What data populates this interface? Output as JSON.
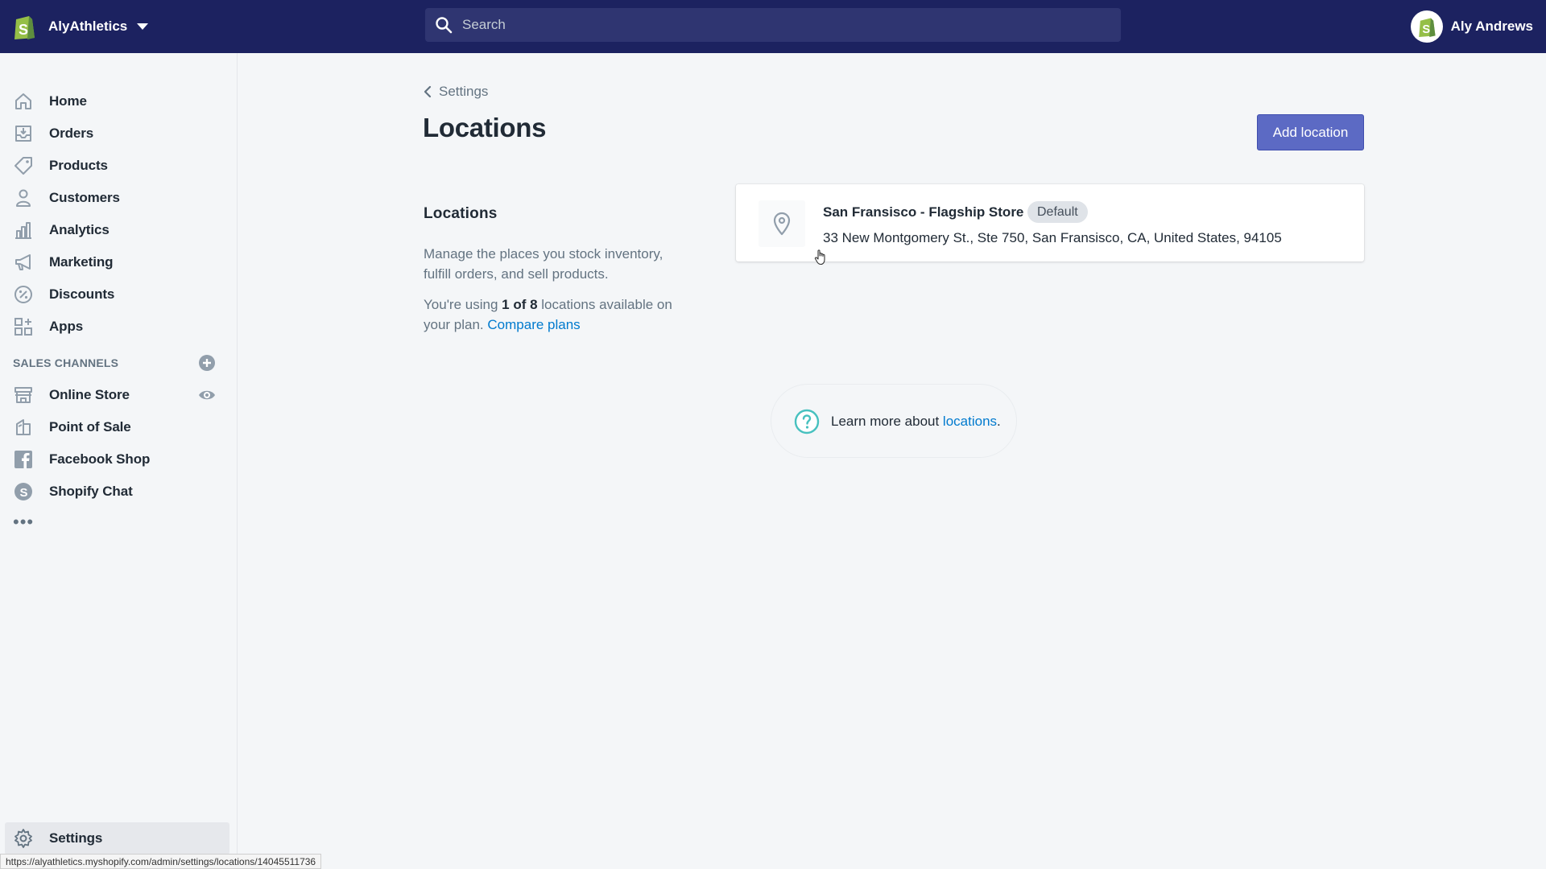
{
  "topbar": {
    "store_name": "AlyAthletics",
    "search_placeholder": "Search",
    "user_name": "Aly Andrews"
  },
  "sidebar": {
    "items": [
      {
        "label": "Home",
        "icon": "home-icon"
      },
      {
        "label": "Orders",
        "icon": "orders-icon"
      },
      {
        "label": "Products",
        "icon": "tag-icon"
      },
      {
        "label": "Customers",
        "icon": "person-icon"
      },
      {
        "label": "Analytics",
        "icon": "bar-chart-icon"
      },
      {
        "label": "Marketing",
        "icon": "megaphone-icon"
      },
      {
        "label": "Discounts",
        "icon": "discount-icon"
      },
      {
        "label": "Apps",
        "icon": "apps-icon"
      }
    ],
    "sales_channels_title": "SALES CHANNELS",
    "channels": [
      {
        "label": "Online Store",
        "icon": "store-icon"
      },
      {
        "label": "Point of Sale",
        "icon": "bag-icon"
      },
      {
        "label": "Facebook Shop",
        "icon": "facebook-icon"
      },
      {
        "label": "Shopify Chat",
        "icon": "chat-icon"
      }
    ],
    "more": "•••",
    "settings_label": "Settings"
  },
  "main": {
    "breadcrumb": "Settings",
    "title": "Locations",
    "add_button": "Add location",
    "section": {
      "heading": "Locations",
      "description": "Manage the places you stock inventory, fulfill orders, and sell products.",
      "usage_prefix": "You're using ",
      "usage_bold": "1 of 8",
      "usage_suffix": " locations available on your plan. ",
      "compare_link": "Compare plans"
    },
    "location": {
      "name": "San Fransisco - Flagship Store",
      "badge": "Default",
      "address": "33 New Montgomery St., Ste 750, San Fransisco, CA, United States, 94105"
    },
    "help": {
      "prefix": "Learn more about ",
      "link": "locations",
      "suffix": "."
    }
  },
  "status_url": "https://alyathletics.myshopify.com/admin/settings/locations/14045511736",
  "colors": {
    "topbar": "#1c2260",
    "primary_button": "#5c6ac4",
    "link": "#007ace"
  }
}
